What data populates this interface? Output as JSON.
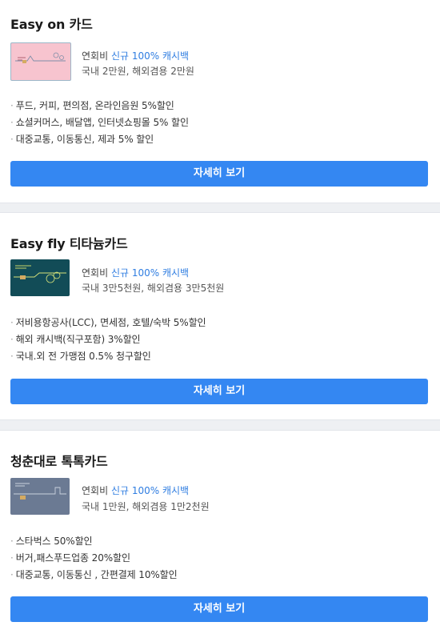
{
  "cards": [
    {
      "name": "Easy on 카드",
      "thumb_color": "#f7c4cf",
      "fee_label": "연회비 ",
      "fee_highlight": "신규 100% 캐시백",
      "fee_detail": "국내 2만원, 해외겸용 2만원",
      "benefits": [
        "푸드, 커피, 편의점, 온라인음원 5%할인",
        "쇼셜커머스, 배달앱, 인터넷쇼핑몰 5% 할인",
        "대중교통, 이동통신, 제과 5% 할인"
      ],
      "button": "자세히 보기"
    },
    {
      "name": "Easy fly 티타늄카드",
      "thumb_color": "#124c57",
      "fee_label": "연회비 ",
      "fee_highlight": "신규 100% 캐시백",
      "fee_detail": "국내 3만5천원, 해외겸용 3만5천원",
      "benefits": [
        "저비용항공사(LCC), 면세점, 호텔/숙박 5%할인",
        "해외 캐시백(직구포함) 3%할인",
        "국내.외 전 가맹점 0.5% 청구할인"
      ],
      "button": "자세히 보기"
    },
    {
      "name": "청춘대로 톡톡카드",
      "thumb_color": "#6b7a93",
      "fee_label": "연회비 ",
      "fee_highlight": "신규 100% 캐시백",
      "fee_detail": "국내 1만원, 해외겸용 1만2천원",
      "benefits": [
        "스타벅스 50%할인",
        "버거,패스푸드업종 20%할인",
        "대중교통, 이동통신 , 간편결제 10%할인"
      ],
      "button": "자세히 보기"
    }
  ],
  "colors": {
    "accent": "#3487f2",
    "highlight": "#2f7de1",
    "separator": "#eef0f3"
  }
}
